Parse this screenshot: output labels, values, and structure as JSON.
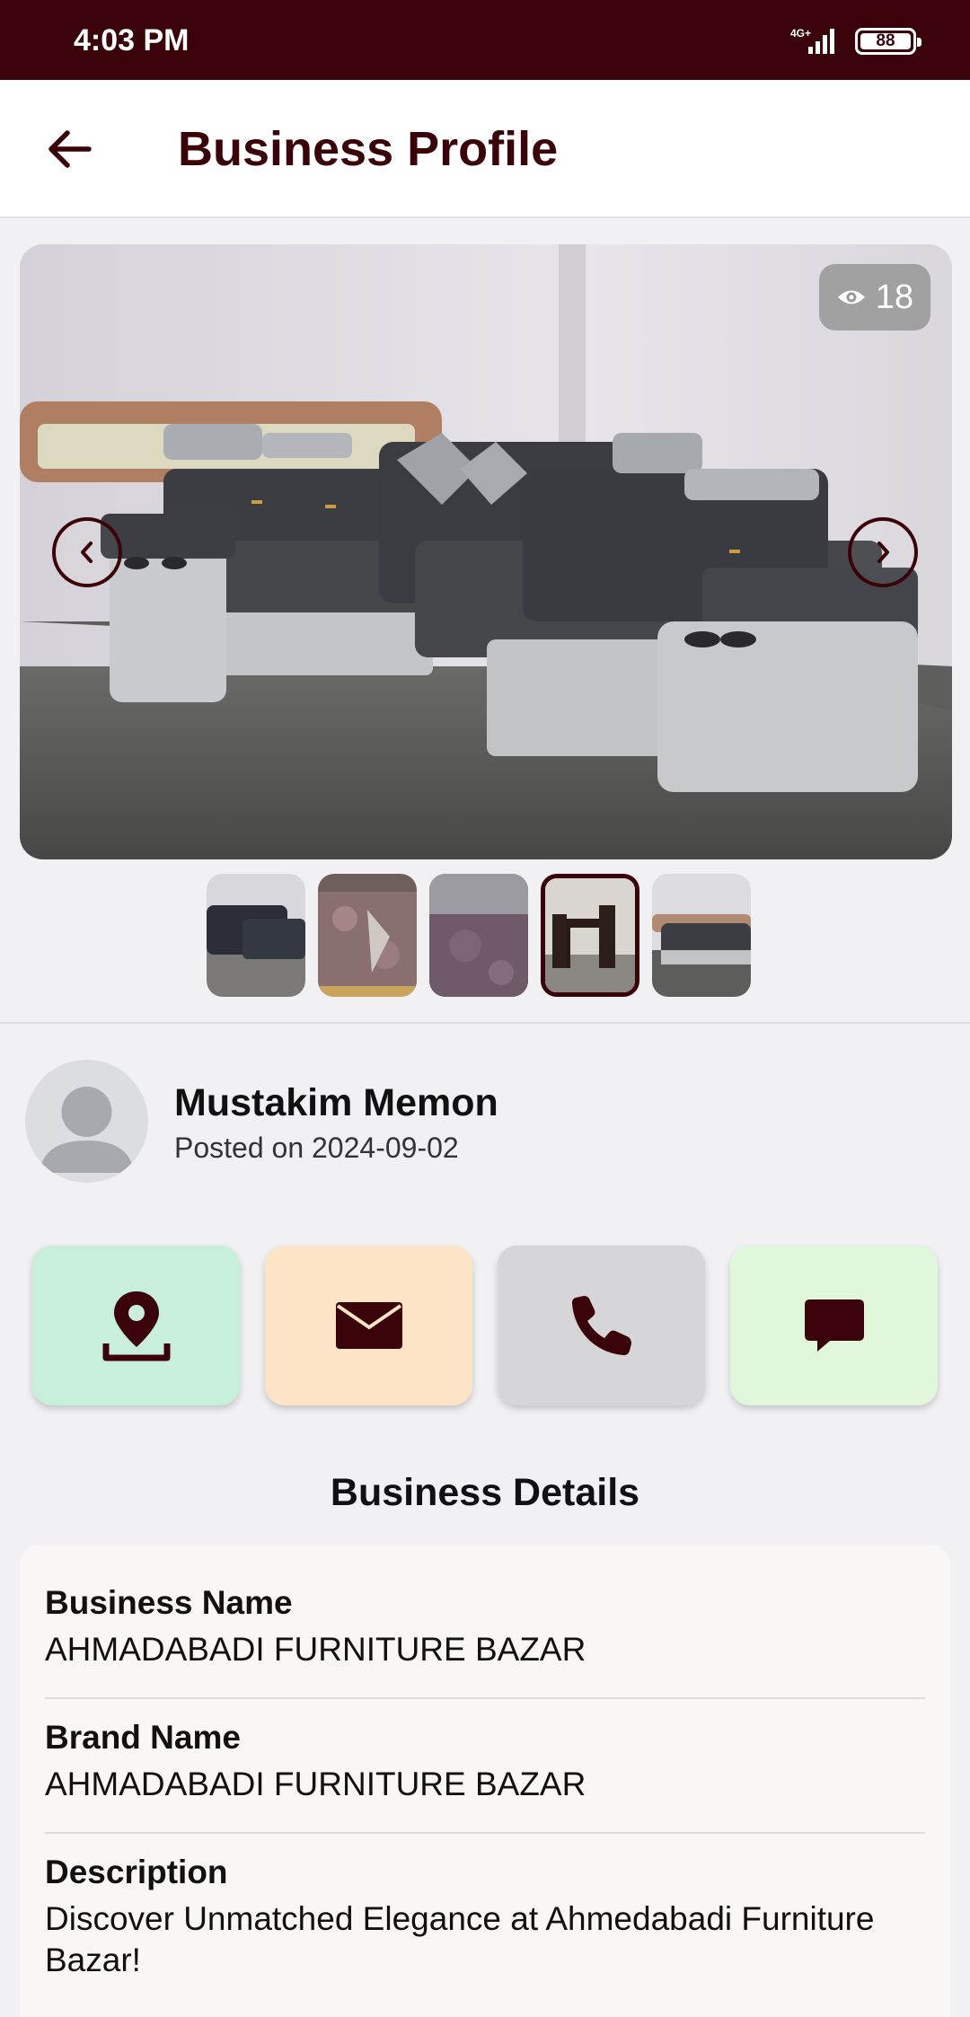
{
  "status_bar": {
    "time": "4:03 PM",
    "network": "4G+",
    "battery": "88"
  },
  "app_bar": {
    "title": "Business Profile",
    "back_icon": "arrow-left-icon"
  },
  "gallery": {
    "views": "18",
    "views_icon": "eye-icon",
    "thumbnail_count": 5,
    "active_thumbnail": 4
  },
  "poster": {
    "name": "Mustakim Memon",
    "posted": "Posted on 2024-09-02"
  },
  "actions": [
    {
      "name": "location",
      "icon": "map-pin-icon",
      "color": "#c8efdc"
    },
    {
      "name": "email",
      "icon": "envelope-icon",
      "color": "#fee4c6"
    },
    {
      "name": "call",
      "icon": "phone-icon",
      "color": "#d6d6d8"
    },
    {
      "name": "chat",
      "icon": "chat-bubble-icon",
      "color": "#e0f7dc"
    }
  ],
  "details": {
    "title": "Business Details",
    "business_name_label": "Business Name",
    "business_name_value": "AHMADABADI FURNITURE BAZAR",
    "brand_name_label": "Brand Name",
    "brand_name_value": "AHMADABADI FURNITURE BAZAR",
    "description_label": "Description",
    "description_value": "Discover Unmatched Elegance at Ahmedabadi Furniture Bazar!"
  },
  "colors": {
    "primary": "#3a0309",
    "background": "#f1f1f3"
  }
}
